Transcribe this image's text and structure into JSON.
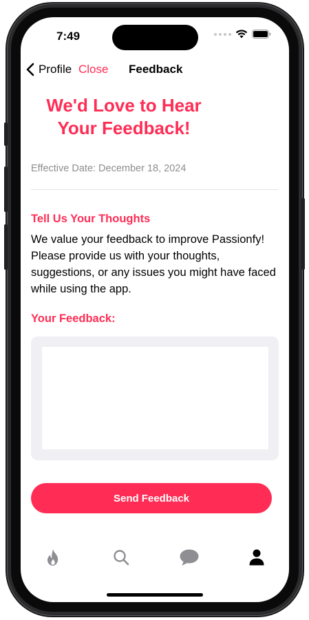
{
  "status_bar": {
    "time": "7:49"
  },
  "nav": {
    "back_label": "Profile",
    "close_label": "Close",
    "title": "Feedback"
  },
  "page": {
    "headline": "We'd Love to Hear Your Feedback!",
    "effective_date": "Effective Date: December 18, 2024",
    "section_title": "Tell Us Your Thoughts",
    "body": "We value your feedback to improve Passionfy! Please provide us with your thoughts, suggestions, or any issues you might have faced while using the app.",
    "feedback_label": "Your Feedback:",
    "feedback_value": "",
    "send_label": "Send Feedback"
  },
  "tab_bar": {
    "tabs": [
      {
        "icon": "flame-icon",
        "selected": false
      },
      {
        "icon": "search-icon",
        "selected": false
      },
      {
        "icon": "chat-bubble-icon",
        "selected": false
      },
      {
        "icon": "person-icon",
        "selected": true
      }
    ]
  },
  "colors": {
    "accent": "#ff2d55",
    "secondary_text": "#8e8e93",
    "tab_inactive": "#8e8e93",
    "tab_active": "#000000",
    "input_background": "#efeff4"
  }
}
